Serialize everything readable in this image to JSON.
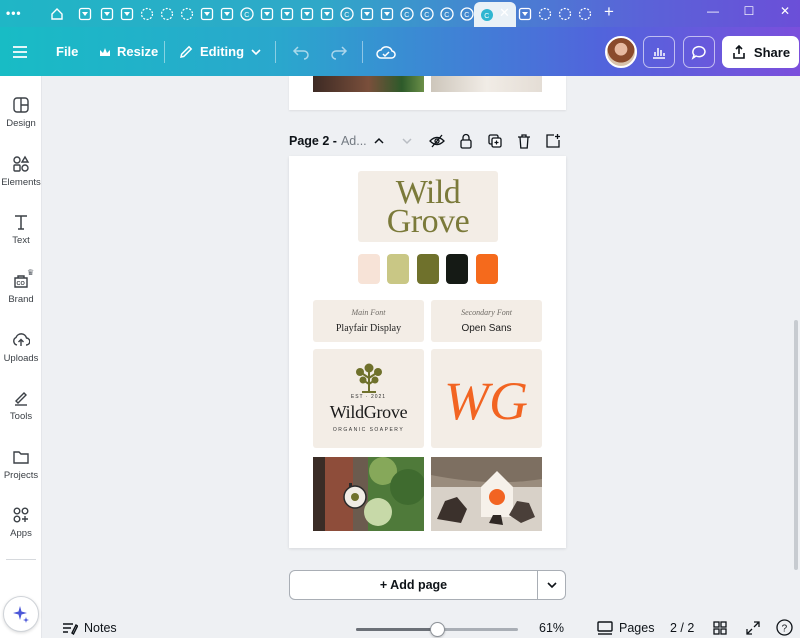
{
  "toolbar": {
    "menu_icon": "hamburger-icon",
    "file_label": "File",
    "resize_label": "Resize",
    "editing_label": "Editing",
    "share_label": "Share"
  },
  "sidebar": {
    "items": [
      {
        "label": "Design",
        "icon": "layout-icon"
      },
      {
        "label": "Elements",
        "icon": "shapes-icon"
      },
      {
        "label": "Text",
        "icon": "text-icon"
      },
      {
        "label": "Brand",
        "icon": "brand-icon"
      },
      {
        "label": "Uploads",
        "icon": "cloud-upload-icon"
      },
      {
        "label": "Tools",
        "icon": "pen-icon"
      },
      {
        "label": "Projects",
        "icon": "folder-icon"
      },
      {
        "label": "Apps",
        "icon": "apps-icon"
      }
    ]
  },
  "page": {
    "name": "Page 2 -",
    "title_placeholder": "Ad...",
    "logo": {
      "line1": "Wild",
      "line2": "Grove"
    },
    "palette": [
      "#f7e3d7",
      "#c9c785",
      "#6f712c",
      "#151a15",
      "#f56a1c"
    ],
    "main_font": {
      "label": "Main Font",
      "value": "Playfair Display"
    },
    "secondary_font": {
      "label": "Secondary Font",
      "value": "Open Sans"
    },
    "brand_mark": {
      "est": "EST · 2021",
      "name": "WildGrove",
      "tagline": "ORGANIC SOAPERY"
    },
    "monogram": "WG",
    "colors": {
      "olive": "#7b7a3a",
      "orange": "#f26422"
    }
  },
  "add_page": {
    "label": "+ Add page"
  },
  "bottombar": {
    "notes_label": "Notes",
    "zoom": "61%",
    "zoom_fraction": 0.5,
    "pages_label": "Pages",
    "page_count": "2 / 2",
    "help": "?"
  }
}
